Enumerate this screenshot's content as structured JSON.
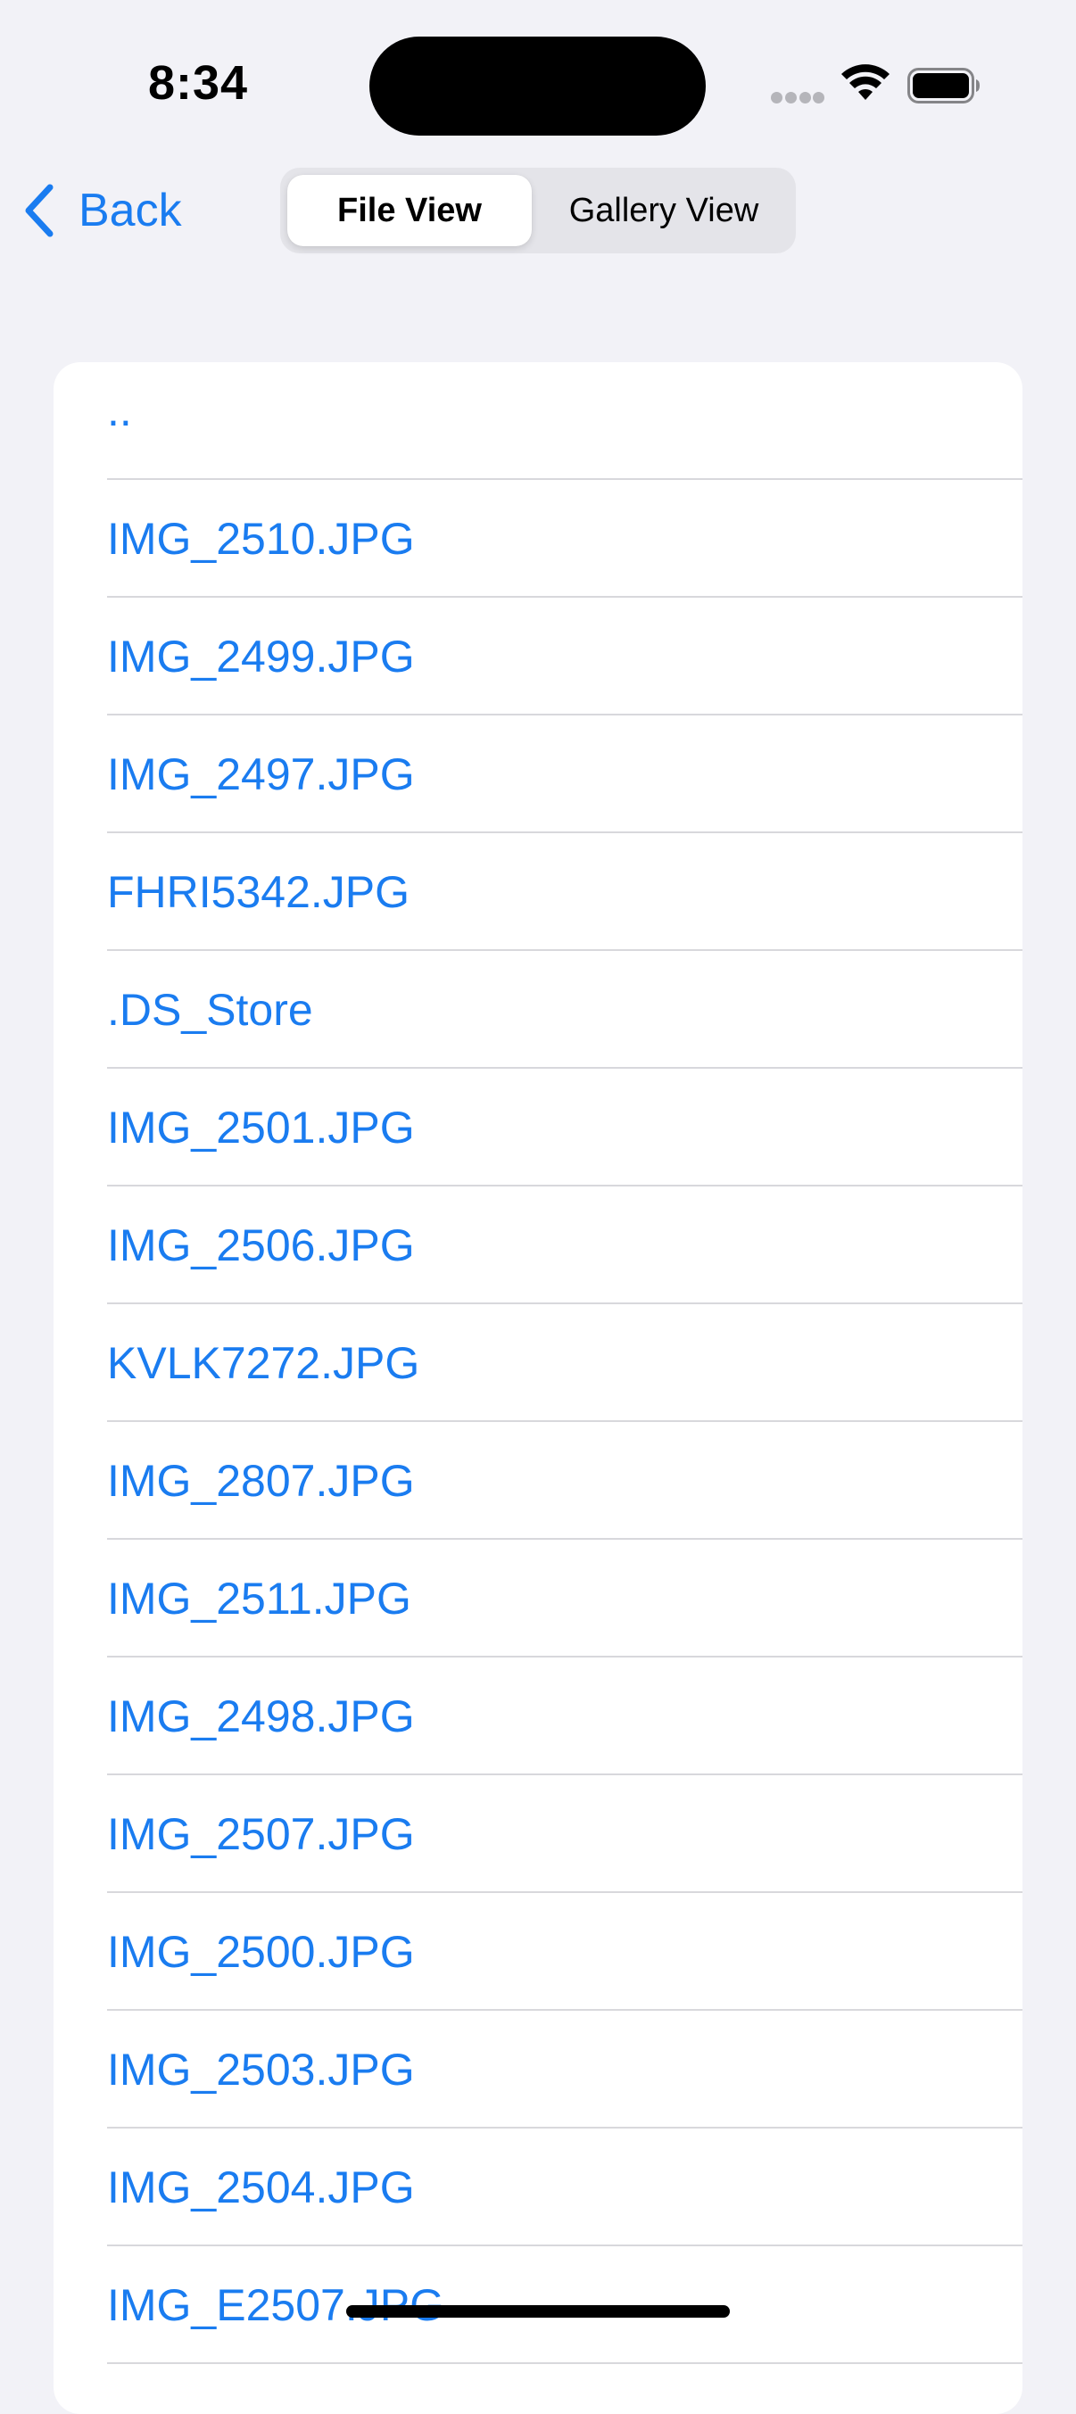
{
  "status_bar": {
    "time": "8:34"
  },
  "nav": {
    "back_label": "Back",
    "segments": [
      {
        "label": "File View",
        "selected": true
      },
      {
        "label": "Gallery View",
        "selected": false
      }
    ]
  },
  "files": [
    "..",
    "IMG_2510.JPG",
    "IMG_2499.JPG",
    "IMG_2497.JPG",
    "FHRI5342.JPG",
    ".DS_Store",
    "IMG_2501.JPG",
    "IMG_2506.JPG",
    "KVLK7272.JPG",
    "IMG_2807.JPG",
    "IMG_2511.JPG",
    "IMG_2498.JPG",
    "IMG_2507.JPG",
    "IMG_2500.JPG",
    "IMG_2503.JPG",
    "IMG_2504.JPG",
    "IMG_E2507.JPG"
  ],
  "colors": {
    "accent": "#1a7cf0",
    "background": "#f2f2f7",
    "card": "#ffffff",
    "divider": "#d8d8dc"
  },
  "icons": {
    "back": "chevron-left-icon",
    "signal": "cellular-signal-icon",
    "wifi": "wifi-icon",
    "battery": "battery-icon"
  }
}
